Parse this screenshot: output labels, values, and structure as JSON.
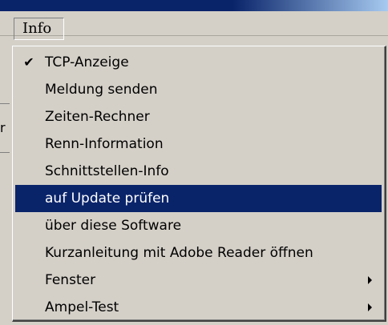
{
  "menubar": {
    "info_label": "Info"
  },
  "background": {
    "left_letter": "r"
  },
  "dropdown": {
    "items": [
      {
        "label": "TCP-Anzeige",
        "checked": true,
        "submenu": false,
        "selected": false
      },
      {
        "label": "Meldung senden",
        "checked": false,
        "submenu": false,
        "selected": false
      },
      {
        "label": "Zeiten-Rechner",
        "checked": false,
        "submenu": false,
        "selected": false
      },
      {
        "label": "Renn-Information",
        "checked": false,
        "submenu": false,
        "selected": false
      },
      {
        "label": "Schnittstellen-Info",
        "checked": false,
        "submenu": false,
        "selected": false
      },
      {
        "label": "auf Update prüfen",
        "checked": false,
        "submenu": false,
        "selected": true
      },
      {
        "label": "über diese Software",
        "checked": false,
        "submenu": false,
        "selected": false
      },
      {
        "label": "Kurzanleitung mit Adobe Reader öffnen",
        "checked": false,
        "submenu": false,
        "selected": false
      },
      {
        "label": "Fenster",
        "checked": false,
        "submenu": true,
        "selected": false
      },
      {
        "label": "Ampel-Test",
        "checked": false,
        "submenu": true,
        "selected": false
      }
    ]
  },
  "colors": {
    "menu_background": "#d4d0c8",
    "selection_background": "#0a246a",
    "selection_text": "#ffffff",
    "titlebar": "#0a246a"
  },
  "icons": {
    "check": "checkmark-icon",
    "submenu": "submenu-arrow-icon"
  }
}
